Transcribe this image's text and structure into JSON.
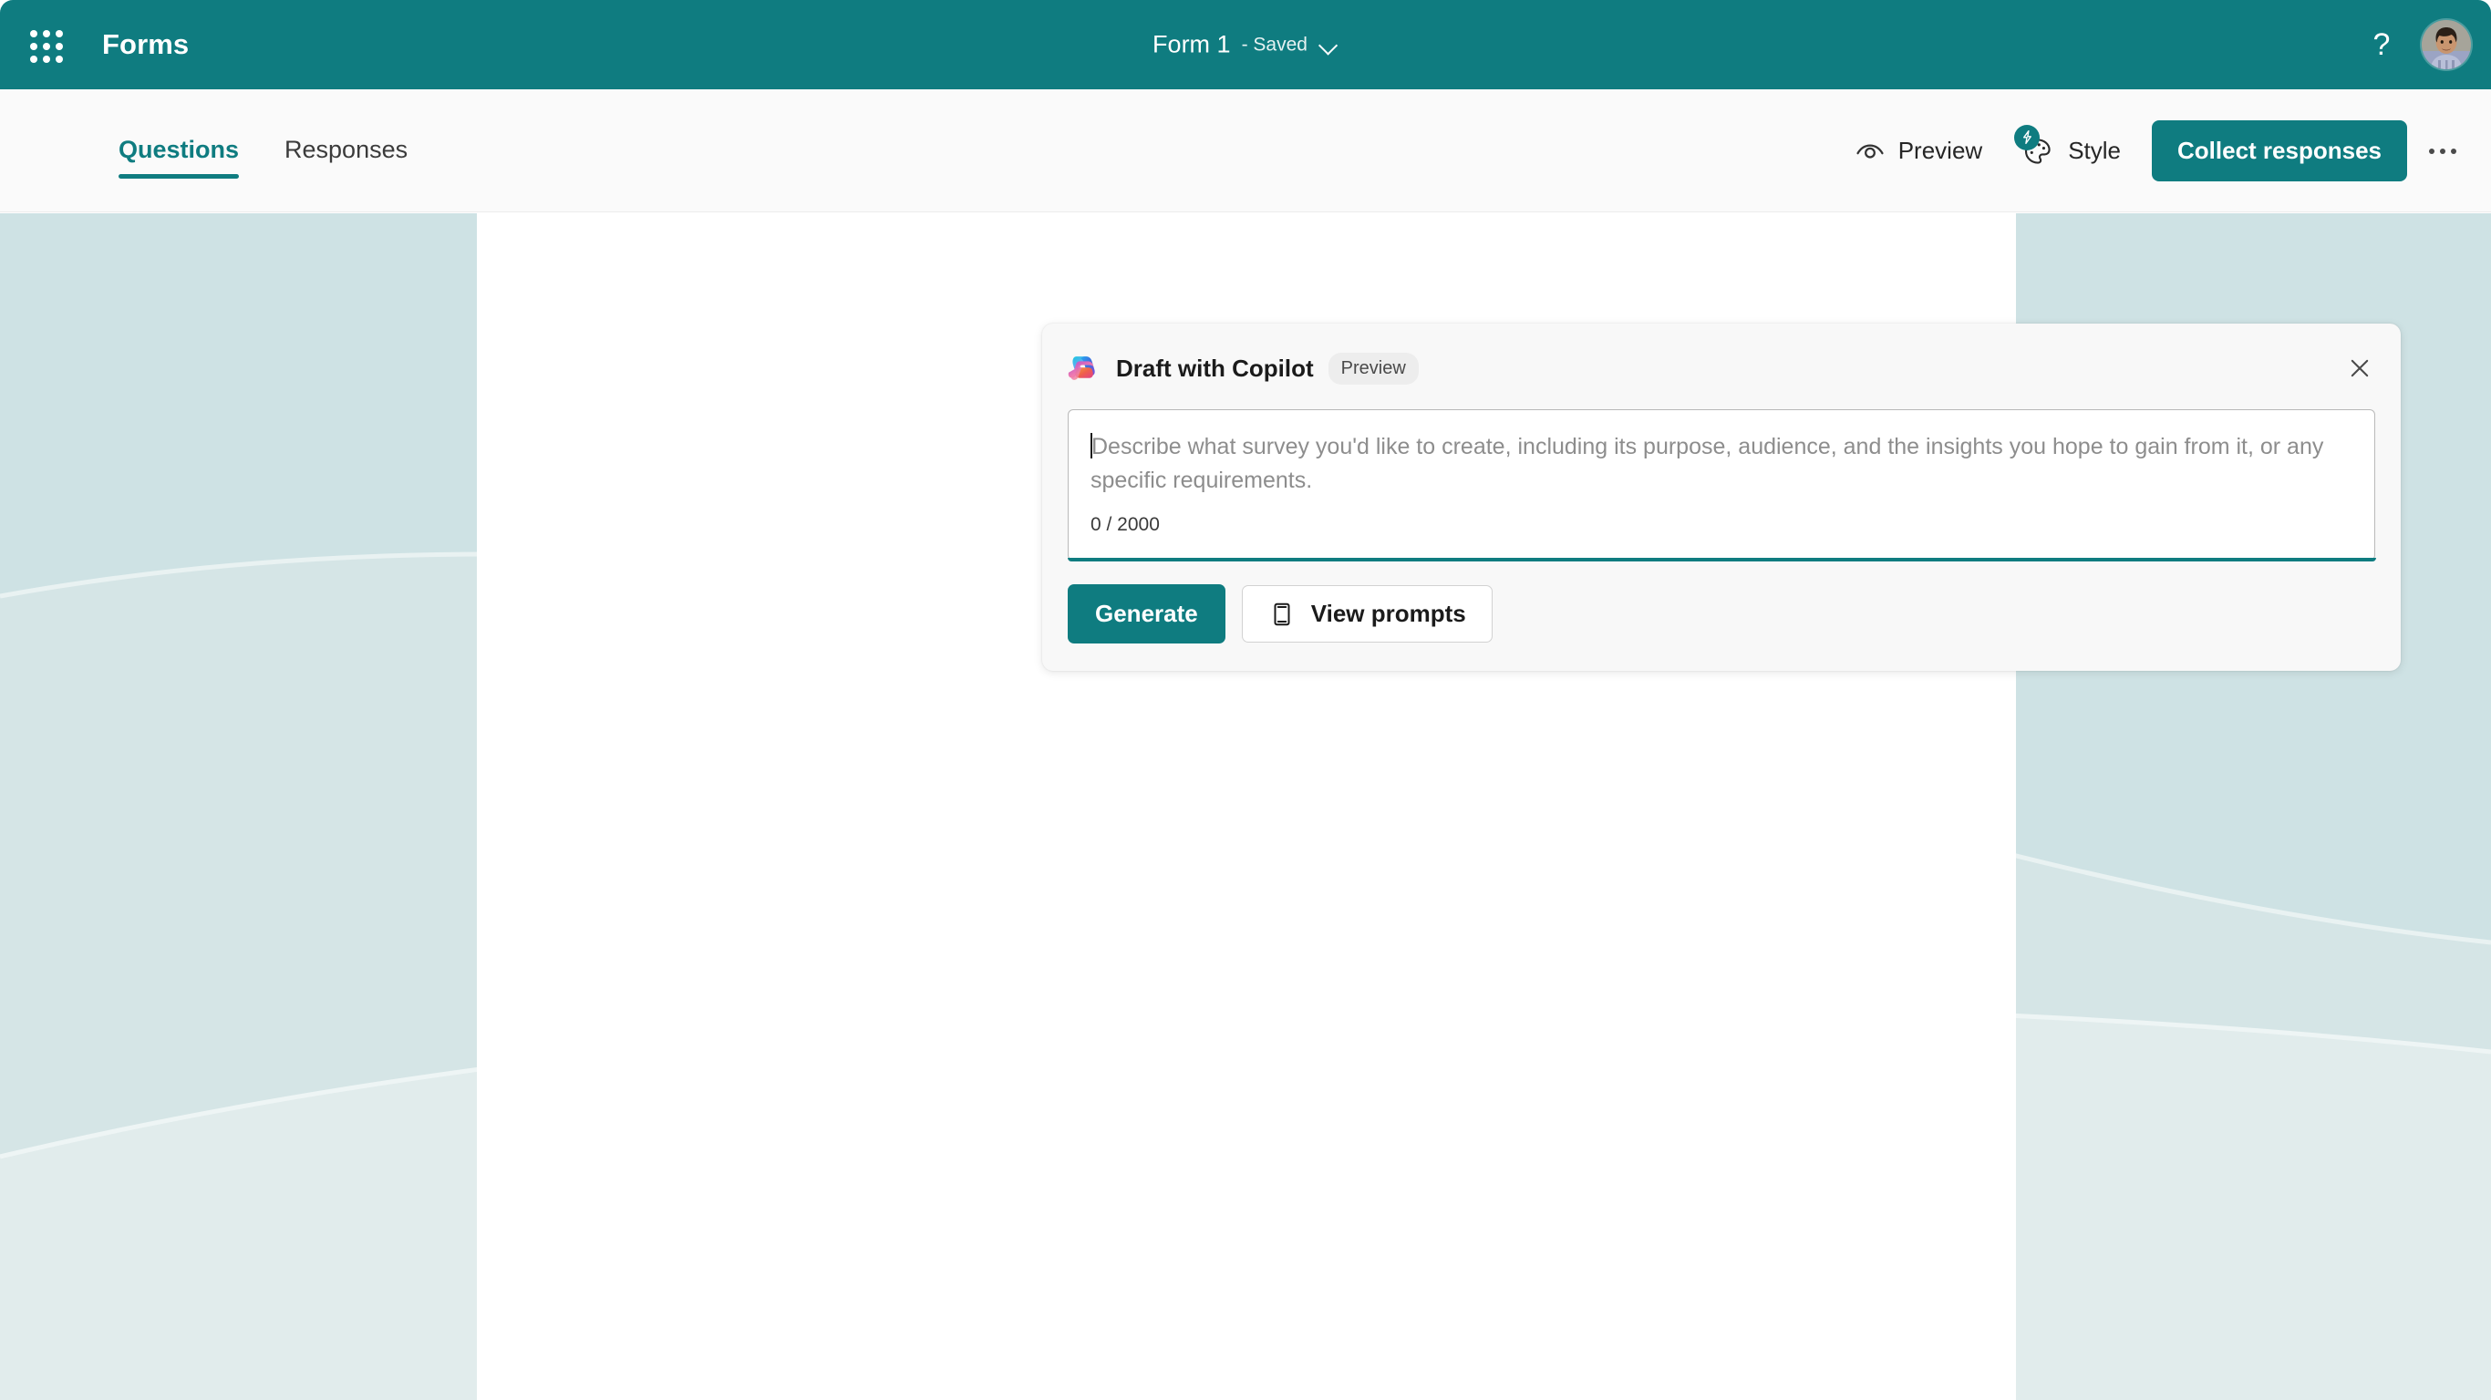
{
  "header": {
    "waffle_icon": "app-launcher-grid-icon",
    "brand": "Forms",
    "doc_title": "Form 1",
    "doc_status": "- Saved",
    "chevron_icon": "chevron-down-icon",
    "help_icon": "?",
    "avatar_label": "account-avatar"
  },
  "commandbar": {
    "tabs": [
      {
        "label": "Questions",
        "active": true
      },
      {
        "label": "Responses",
        "active": false
      }
    ],
    "preview_label": "Preview",
    "preview_icon": "eye-icon",
    "style_label": "Style",
    "style_icon": "palette-icon",
    "style_badge_icon": "lightning-bolt-icon",
    "collect_label": "Collect responses",
    "more_icon": "ellipsis-horizontal-icon"
  },
  "copilot_card": {
    "logo_icon": "copilot-icon",
    "title": "Draft with Copilot",
    "badge": "Preview",
    "close_icon": "close-icon",
    "prompt_placeholder": "Describe what survey you'd like to create, including its purpose, audience, and the insights you hope to gain from it, or any specific requirements.",
    "prompt_value": "",
    "counter": "0 / 2000",
    "generate_label": "Generate",
    "view_prompts_label": "View prompts",
    "view_prompts_icon": "book-icon"
  },
  "colors": {
    "brand_teal": "#0f7c80",
    "canvas_teal": "#cee2e4",
    "card_bg": "#f8f8f8",
    "sheet_white": "#ffffff"
  }
}
